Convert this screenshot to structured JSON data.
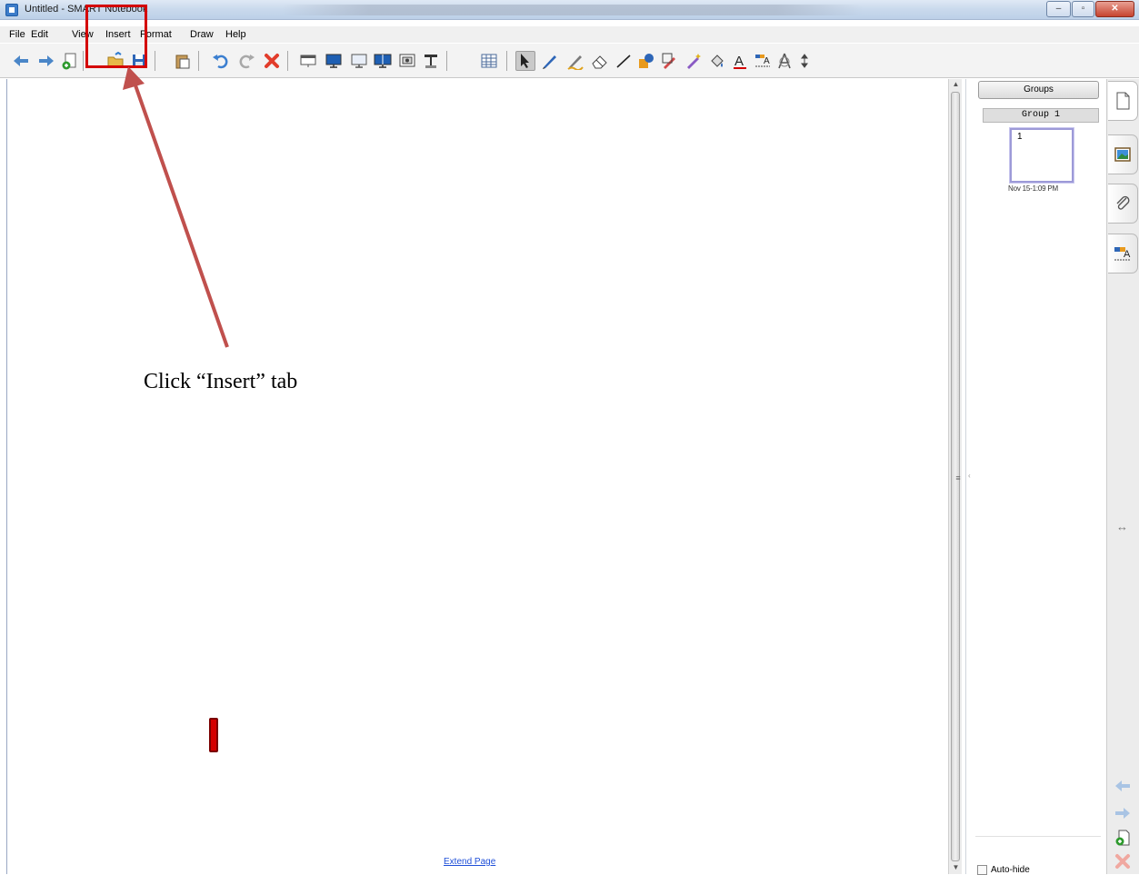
{
  "window": {
    "title": "Untitled - SMART Notebook",
    "controls": {
      "minimize": "–",
      "maximize": "▫",
      "close": "✕"
    }
  },
  "menu": [
    "File",
    "Edit",
    "View",
    "Insert",
    "Format",
    "Draw",
    "Help"
  ],
  "toolbar": {
    "icons": [
      "back-arrow-icon",
      "forward-arrow-icon",
      "add-page-icon",
      "open-file-icon",
      "save-icon",
      "paste-icon",
      "undo-icon",
      "redo-icon",
      "delete-icon",
      "screen-shade-icon",
      "full-screen-icon",
      "transparent-background-icon",
      "dual-page-icon",
      "screen-capture-icon",
      "document-camera-icon",
      "table-icon",
      "select-icon",
      "pen-icon",
      "creative-pen-icon",
      "eraser-icon",
      "line-icon",
      "shape-icon",
      "magic-pen-icon",
      "shape-recognition-pen-icon",
      "fill-icon",
      "text-icon",
      "properties-icon",
      "measurement-tools-icon",
      "move-toolbar-icon"
    ]
  },
  "canvas": {
    "instruction": "Click “Insert” tab",
    "extend_page": "Extend Page"
  },
  "sidebar": {
    "groups_button": "Groups",
    "group_name": "Group 1",
    "page_number": "1",
    "page_date": "Nov 15-1:09 PM",
    "auto_hide": "Auto-hide"
  },
  "side_tabs": [
    "page-sorter-icon",
    "gallery-icon",
    "attachments-icon",
    "properties-icon"
  ],
  "colors": {
    "highlight": "#d40000",
    "arrow": "#c0504d",
    "link": "#1f4fd8",
    "thumb_border": "#9d9ad8"
  }
}
